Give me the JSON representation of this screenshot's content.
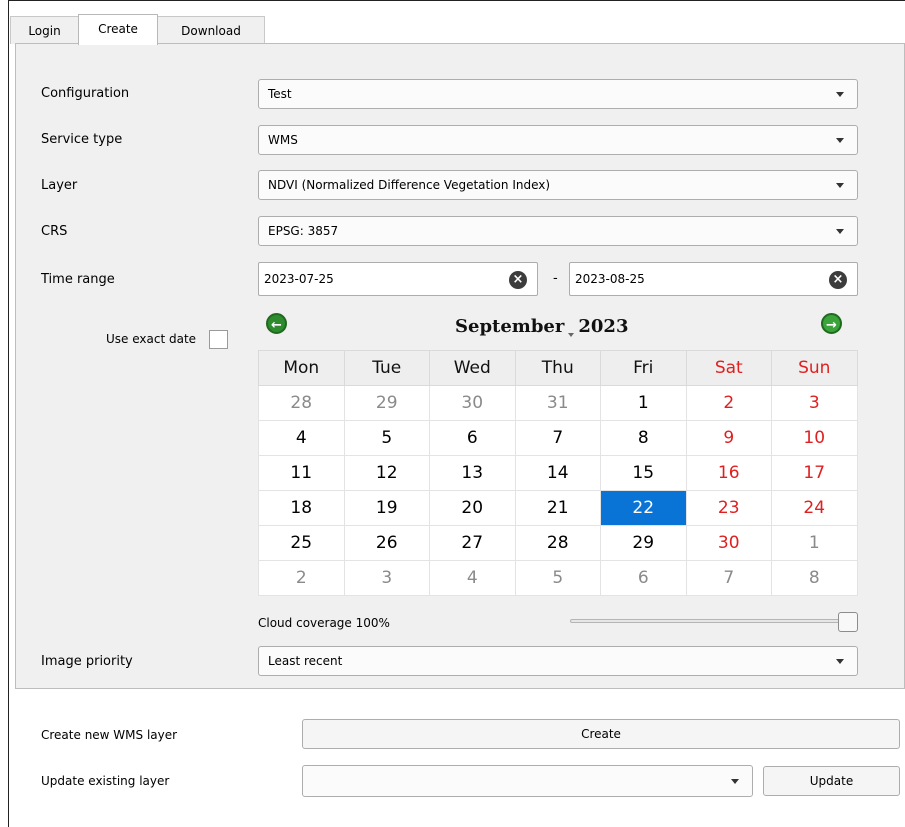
{
  "tabs": [
    {
      "label": "Login"
    },
    {
      "label": "Create"
    },
    {
      "label": "Download"
    }
  ],
  "form": {
    "configuration": {
      "label": "Configuration",
      "value": "Test"
    },
    "service_type": {
      "label": "Service type",
      "value": "WMS"
    },
    "layer": {
      "label": "Layer",
      "value": "NDVI (Normalized Difference Vegetation Index)"
    },
    "crs": {
      "label": "CRS",
      "value": "EPSG: 3857"
    },
    "time_range": {
      "label": "Time range",
      "start": "2023-07-25",
      "separator": "-",
      "end": "2023-08-25"
    },
    "use_exact_date": {
      "label": "Use exact date",
      "checked": false
    },
    "cloud_coverage": {
      "label": "Cloud coverage 100%",
      "percent": 100
    },
    "image_priority": {
      "label": "Image priority",
      "value": "Least recent"
    }
  },
  "calendar": {
    "month": "September",
    "year": "2023",
    "weekdays": [
      "Mon",
      "Tue",
      "Wed",
      "Thu",
      "Fri",
      "Sat",
      "Sun"
    ],
    "weeks": [
      [
        "28",
        "29",
        "30",
        "31",
        "1",
        "2",
        "3"
      ],
      [
        "4",
        "5",
        "6",
        "7",
        "8",
        "9",
        "10"
      ],
      [
        "11",
        "12",
        "13",
        "14",
        "15",
        "16",
        "17"
      ],
      [
        "18",
        "19",
        "20",
        "21",
        "22",
        "23",
        "24"
      ],
      [
        "25",
        "26",
        "27",
        "28",
        "29",
        "30",
        "1"
      ],
      [
        "2",
        "3",
        "4",
        "5",
        "6",
        "7",
        "8"
      ]
    ],
    "selected": "22"
  },
  "actions": {
    "create_label": "Create new WMS layer",
    "create_button": "Create",
    "update_label": "Update existing layer",
    "update_value": "",
    "update_button": "Update"
  },
  "colors": {
    "weekend": "#e02020",
    "selected_bg": "#0a74d6",
    "other_month": "#8a8a8a"
  }
}
